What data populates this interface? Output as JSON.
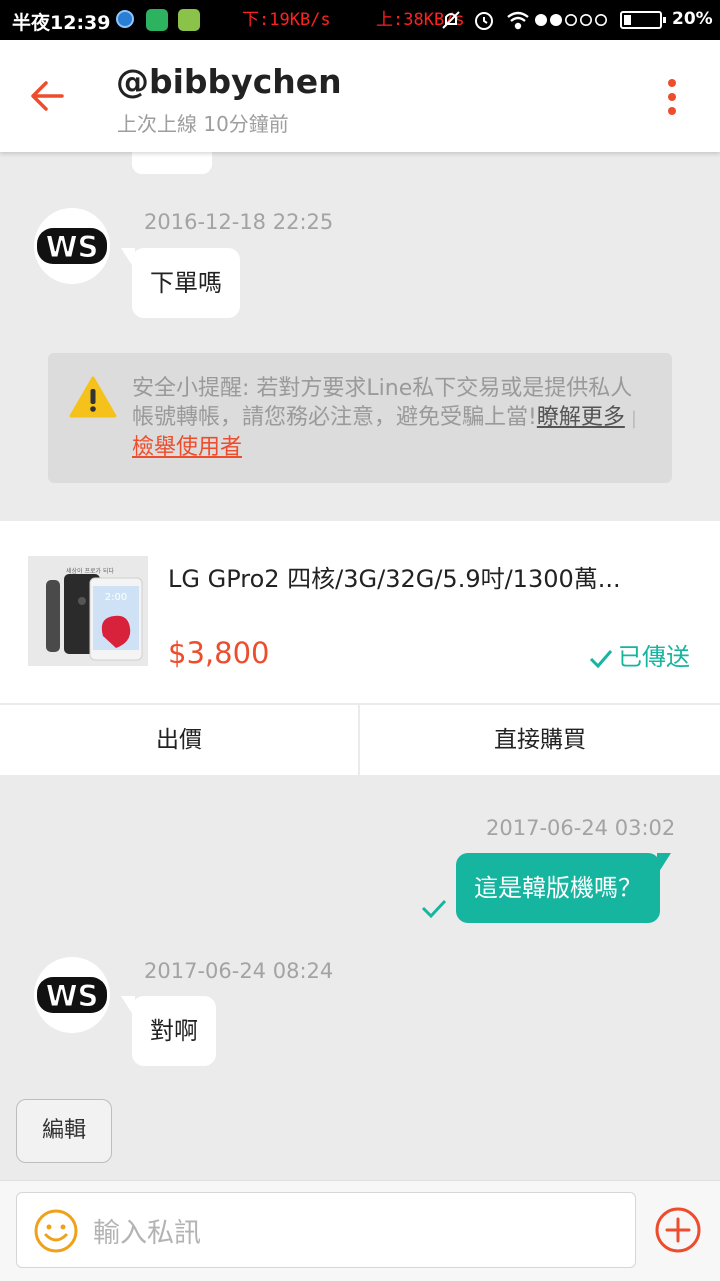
{
  "status_bar": {
    "time": "半夜12:39",
    "download_speed": "下:19KB/s",
    "upload_speed": "上:38KB/s",
    "signal_icon": "signal-dots-icon",
    "battery_percent": "20%",
    "battery_level": 0.2
  },
  "header": {
    "title": "@bibbychen",
    "subtitle": "上次上線 10分鐘前",
    "back_icon": "back-arrow-icon",
    "menu_icon": "more-vertical-icon"
  },
  "messages": [
    {
      "direction": "incoming",
      "timestamp": "2016-12-18 22:25",
      "text": "下單嗎",
      "avatar_text": "WS"
    },
    {
      "direction": "outgoing",
      "timestamp": "2017-06-24 03:02",
      "text": "這是韓版機嗎？",
      "read": true
    },
    {
      "direction": "incoming",
      "timestamp": "2017-06-24 08:24",
      "text": "對啊",
      "avatar_text": "WS"
    }
  ],
  "notice": {
    "text": "安全小提醒: 若對方要求Line私下交易或是提供私人帳號轉帳，請您務必注意，避免受騙上當!",
    "learn_more": "瞭解更多",
    "separator": "|",
    "report": "檢舉使用者"
  },
  "product": {
    "title": "LG GPro2 四核/3G/32G/5.9吋/1300萬...",
    "price": "$3,800",
    "status": "已傳送",
    "offer_label": "出價",
    "buy_label": "直接購買",
    "image_caption": "세상이 프로가 되다",
    "image_clock": "2:00"
  },
  "edit_label": "編輯",
  "input": {
    "placeholder": "輸入私訊",
    "emoji_icon": "smiley-icon",
    "add_icon": "plus-circle-icon"
  },
  "colors": {
    "accent": "#ee4d2d",
    "teal": "#16b5a0",
    "background": "#ebebeb"
  }
}
